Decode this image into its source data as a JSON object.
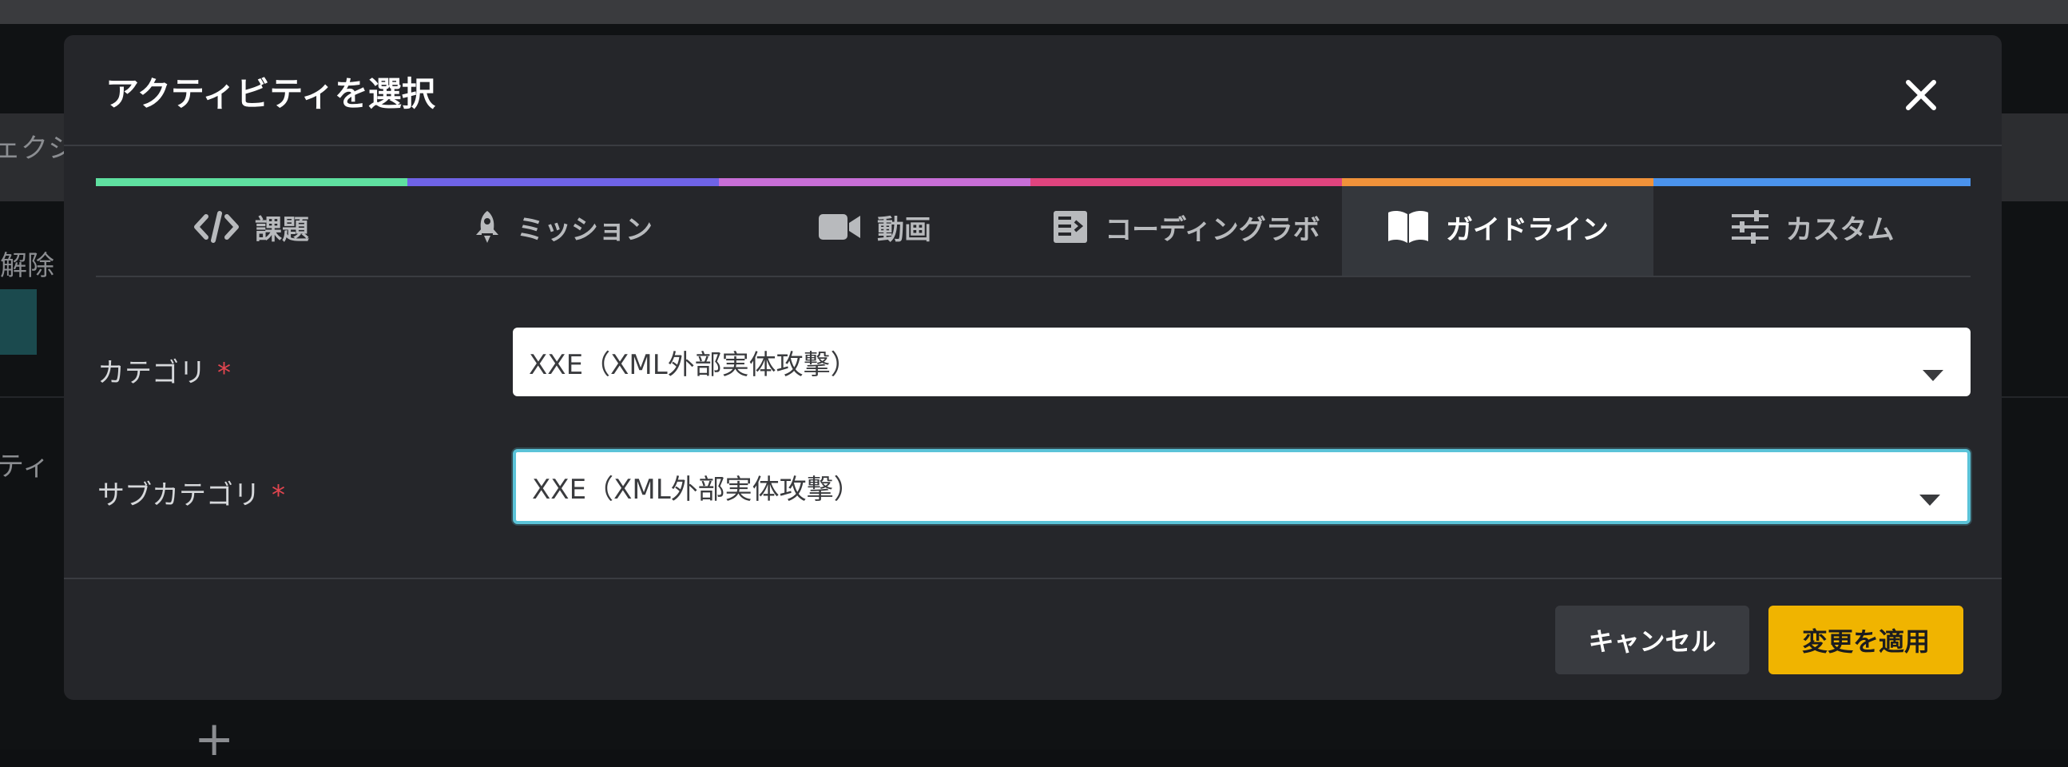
{
  "background": {
    "text_1": "ェクシ",
    "text_2": "解除",
    "text_3": "ティ",
    "plus": "+"
  },
  "modal": {
    "title": "アクティビティを選択",
    "close_icon": "close-icon"
  },
  "tabs": [
    {
      "label": "課題",
      "icon": "code-icon",
      "color": "#5fe0a0"
    },
    {
      "label": "ミッション",
      "icon": "rocket-icon",
      "color": "#6f63e6"
    },
    {
      "label": "動画",
      "icon": "video-camera-icon",
      "color": "#c86ed6"
    },
    {
      "label": "コーディングラボ",
      "icon": "code-lab-icon",
      "color": "#e0447e"
    },
    {
      "label": "ガイドライン",
      "icon": "book-icon",
      "color": "#f0923a",
      "active": true
    },
    {
      "label": "カスタム",
      "icon": "sliders-icon",
      "color": "#4b93ec"
    }
  ],
  "form": {
    "category": {
      "label": "カテゴリ",
      "required_mark": "*",
      "value": "XXE（XML外部実体攻撃）"
    },
    "subcategory": {
      "label": "サブカテゴリ",
      "required_mark": "*",
      "value": "XXE（XML外部実体攻撃）"
    }
  },
  "footer": {
    "cancel_label": "キャンセル",
    "apply_label": "変更を適用"
  },
  "colors": {
    "accent_apply": "#f0b400",
    "focus_ring": "#5bc3d8",
    "required": "#e0454f"
  }
}
